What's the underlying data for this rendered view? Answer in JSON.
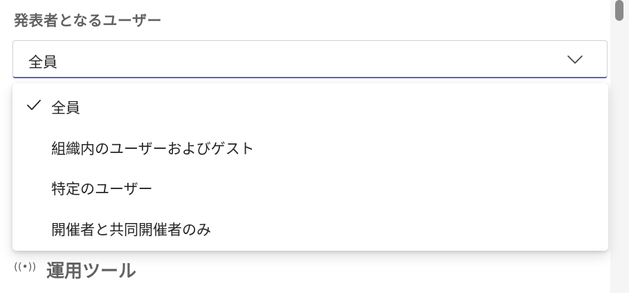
{
  "field": {
    "label": "発表者となるユーザー",
    "selected_value": "全員"
  },
  "dropdown": {
    "options": [
      {
        "label": "全員",
        "selected": true
      },
      {
        "label": "組織内のユーザーおよびゲスト",
        "selected": false
      },
      {
        "label": "特定のユーザー",
        "selected": false
      },
      {
        "label": "開催者と共同開催者のみ",
        "selected": false
      }
    ]
  },
  "section": {
    "icon": "broadcast-icon",
    "icon_glyph": "((•))",
    "title": "運用ツール"
  },
  "colors": {
    "accent": "#5b5fc7",
    "label_gray": "#616161",
    "text": "#242424"
  }
}
